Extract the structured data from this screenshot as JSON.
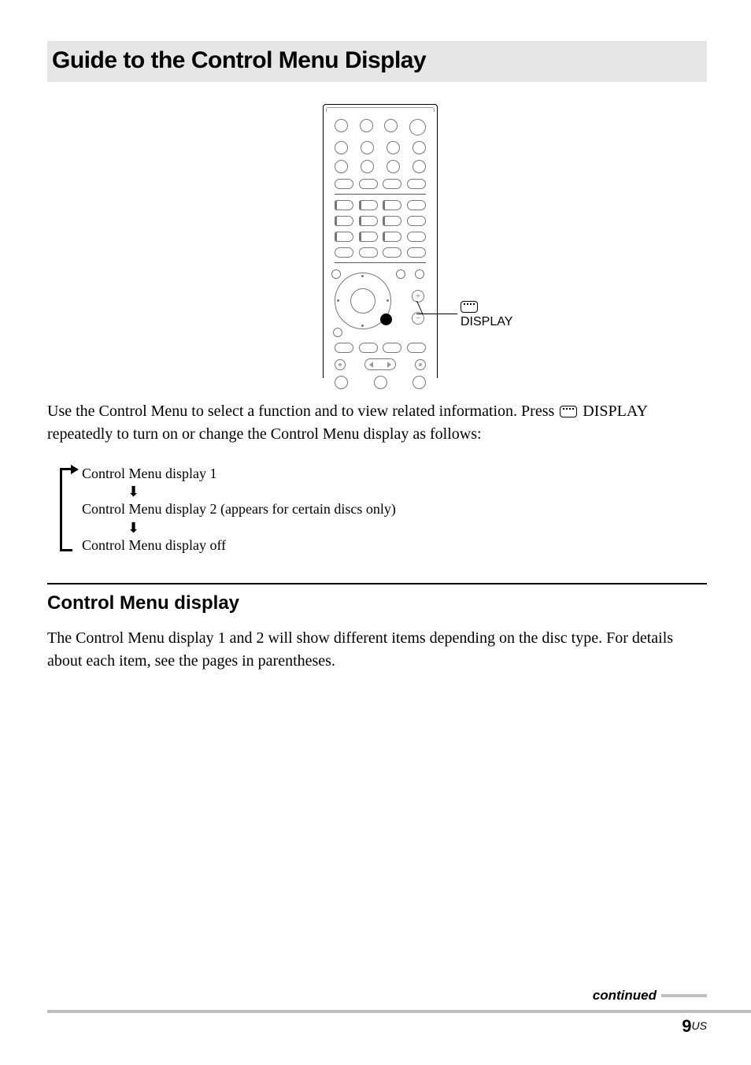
{
  "title": "Guide to the Control Menu Display",
  "calloutLabel": "DISPLAY",
  "bodyParagraph": {
    "part1": "Use the Control Menu to select a function and to view related information. Press ",
    "part2": " DISPLAY repeatedly to turn on or change the Control Menu display as follows:"
  },
  "cycle": {
    "line1": "Control Menu display 1",
    "line2": "Control Menu display 2 (appears for certain discs only)",
    "line3": "Control Menu display off"
  },
  "section": {
    "heading": "Control Menu display",
    "body": "The Control Menu display 1 and 2 will show different items depending on the disc type. For details about each item, see the pages in parentheses."
  },
  "footer": {
    "continued": "continued",
    "pageNumber": "9",
    "region": "US"
  }
}
